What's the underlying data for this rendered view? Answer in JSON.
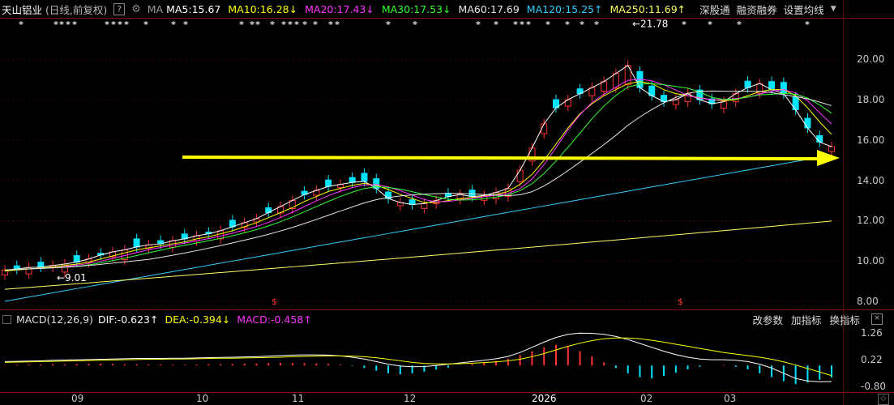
{
  "header": {
    "stock_name": "天山铝业",
    "mode": "(日线,前复权)",
    "help": "?",
    "ma_label": "MA",
    "ma_items": [
      {
        "label": "MA5:15.67",
        "color": "#ffffff"
      },
      {
        "label": "MA10:16.28",
        "arrow": "↓",
        "color": "#ffff00"
      },
      {
        "label": "MA20:17.43",
        "arrow": "↓",
        "color": "#ff33ff"
      },
      {
        "label": "MA30:17.53",
        "arrow": "↓",
        "color": "#33ff33"
      },
      {
        "label": "MA60:17.69",
        "color": "#e6e6e6"
      },
      {
        "label": "MA120:15.25",
        "arrow": "↑",
        "color": "#33ccff"
      },
      {
        "label": "MA250:11.69",
        "arrow": "↑",
        "color": "#ffff66"
      }
    ],
    "links": [
      "深股通",
      "融资融券",
      "设置均线"
    ],
    "dropdown_icon": "chevron-down-icon"
  },
  "price_axis": {
    "ticks": [
      "20.00",
      "18.00",
      "16.00",
      "14.00",
      "12.00",
      "10.00",
      "8.00"
    ]
  },
  "annotations": {
    "high": "21.78",
    "low": "9.01",
    "high_arrow": "←",
    "low_arrow": "←",
    "dividend_marker": "$"
  },
  "macd": {
    "label": "MACD(12,26,9)",
    "dif": {
      "label": "DIF:-0.623",
      "arrow": "↑",
      "color": "#ffffff"
    },
    "dea": {
      "label": "DEA:-0.394",
      "arrow": "↓",
      "color": "#ffff00"
    },
    "macd": {
      "label": "MACD:-0.458",
      "arrow": "↑",
      "color": "#ff33ff"
    },
    "links": [
      "改参数",
      "加指标",
      "换指标"
    ],
    "close": "×",
    "ticks": [
      "1.26",
      "0.22",
      "-0.80"
    ]
  },
  "date_axis": {
    "labels": [
      "09",
      "10",
      "11",
      "12",
      "2026",
      "02",
      "03"
    ]
  },
  "colors": {
    "up": "#ff3232",
    "down": "#00e5ff",
    "arrow": "#ffff00",
    "grid": "#7a1010"
  },
  "chart_data": [
    {
      "type": "line",
      "title": "",
      "description_series": "candlestick daily closes (approx.)",
      "x_range": [
        "2025-08-13",
        "2026-03-20"
      ],
      "ylim": [
        8.0,
        21.5
      ],
      "yscale": "linear",
      "grid": true,
      "series": [
        {
          "name": "MA5",
          "values": [
            9.55,
            9.6,
            9.68,
            9.7,
            9.78,
            9.85,
            9.95,
            10.1,
            10.3,
            10.45,
            10.55,
            10.7,
            10.8,
            10.85,
            11.0,
            11.1,
            11.25,
            11.35,
            11.5,
            11.7,
            11.9,
            12.1,
            12.4,
            12.7,
            13.0,
            13.3,
            13.5,
            13.7,
            13.8,
            13.9,
            13.95,
            13.6,
            13.1,
            12.9,
            12.8,
            12.85,
            13.0,
            13.2,
            13.3,
            13.2,
            13.25,
            13.4,
            13.6,
            14.5,
            15.6,
            16.8,
            17.6,
            18.0,
            18.3,
            18.6,
            18.9,
            19.3,
            19.7,
            18.6,
            18.2,
            17.9,
            18.0,
            18.3,
            18.0,
            17.8,
            17.9,
            18.3,
            18.6,
            18.8,
            18.5,
            18.3,
            17.5,
            16.6,
            15.9,
            15.67
          ]
        },
        {
          "name": "MA10",
          "values": [
            9.5,
            9.55,
            9.6,
            9.65,
            9.7,
            9.78,
            9.85,
            9.95,
            10.1,
            10.25,
            10.4,
            10.55,
            10.65,
            10.75,
            10.85,
            10.95,
            11.1,
            11.2,
            11.35,
            11.5,
            11.7,
            11.9,
            12.15,
            12.4,
            12.65,
            12.95,
            13.2,
            13.45,
            13.6,
            13.75,
            13.85,
            13.75,
            13.55,
            13.3,
            13.1,
            12.9,
            12.9,
            13.0,
            13.1,
            13.15,
            13.2,
            13.3,
            13.45,
            13.8,
            14.3,
            15.0,
            15.8,
            16.6,
            17.3,
            17.8,
            18.2,
            18.5,
            18.8,
            18.9,
            18.8,
            18.5,
            18.3,
            18.2,
            18.1,
            18.0,
            17.95,
            18.0,
            18.2,
            18.4,
            18.5,
            18.5,
            18.2,
            17.6,
            16.9,
            16.28
          ]
        }
      ]
    },
    {
      "type": "bar",
      "title": "",
      "ylim": [
        -0.8,
        1.26
      ],
      "yticks": [
        1.26,
        0.22,
        -0.8
      ],
      "series": [
        {
          "name": "MACD",
          "values": [
            0.02,
            0.03,
            0.04,
            0.04,
            0.05,
            0.04,
            0.05,
            0.06,
            0.07,
            0.06,
            0.05,
            0.05,
            0.04,
            0.04,
            0.03,
            0.03,
            0.04,
            0.05,
            0.05,
            0.06,
            0.07,
            0.08,
            0.09,
            0.1,
            0.1,
            0.09,
            0.08,
            0.06,
            0.03,
            -0.02,
            -0.1,
            -0.2,
            -0.3,
            -0.34,
            -0.3,
            -0.24,
            -0.16,
            -0.08,
            0.0,
            0.06,
            0.12,
            0.18,
            0.26,
            0.4,
            0.55,
            0.7,
            0.8,
            0.72,
            0.55,
            0.35,
            0.12,
            -0.1,
            -0.3,
            -0.45,
            -0.5,
            -0.4,
            -0.28,
            -0.15,
            -0.05,
            0.0,
            0.02,
            -0.05,
            -0.15,
            -0.3,
            -0.45,
            -0.6,
            -0.72,
            -0.66,
            -0.55,
            -0.458
          ]
        },
        {
          "name": "DIF",
          "values": [
            0.15,
            0.16,
            0.17,
            0.18,
            0.2,
            0.21,
            0.22,
            0.23,
            0.24,
            0.25,
            0.26,
            0.27,
            0.27,
            0.27,
            0.28,
            0.28,
            0.29,
            0.3,
            0.31,
            0.32,
            0.33,
            0.34,
            0.36,
            0.38,
            0.4,
            0.41,
            0.41,
            0.4,
            0.37,
            0.32,
            0.25,
            0.15,
            0.05,
            -0.02,
            -0.05,
            -0.04,
            0.0,
            0.05,
            0.1,
            0.15,
            0.2,
            0.26,
            0.35,
            0.5,
            0.7,
            0.9,
            1.08,
            1.2,
            1.25,
            1.24,
            1.2,
            1.12,
            1.0,
            0.85,
            0.7,
            0.55,
            0.42,
            0.32,
            0.25,
            0.22,
            0.22,
            0.2,
            0.15,
            0.05,
            -0.1,
            -0.3,
            -0.5,
            -0.6,
            -0.63,
            -0.623
          ]
        },
        {
          "name": "DEA",
          "values": [
            0.12,
            0.13,
            0.14,
            0.15,
            0.16,
            0.17,
            0.18,
            0.19,
            0.2,
            0.21,
            0.22,
            0.23,
            0.24,
            0.24,
            0.25,
            0.25,
            0.26,
            0.27,
            0.28,
            0.28,
            0.29,
            0.3,
            0.31,
            0.32,
            0.34,
            0.35,
            0.36,
            0.37,
            0.37,
            0.36,
            0.34,
            0.3,
            0.24,
            0.18,
            0.12,
            0.08,
            0.06,
            0.06,
            0.07,
            0.09,
            0.11,
            0.14,
            0.18,
            0.24,
            0.34,
            0.46,
            0.6,
            0.74,
            0.86,
            0.96,
            1.03,
            1.06,
            1.06,
            1.03,
            0.97,
            0.9,
            0.82,
            0.74,
            0.66,
            0.58,
            0.5,
            0.44,
            0.38,
            0.32,
            0.24,
            0.14,
            0.02,
            -0.12,
            -0.25,
            -0.394
          ]
        }
      ]
    }
  ]
}
